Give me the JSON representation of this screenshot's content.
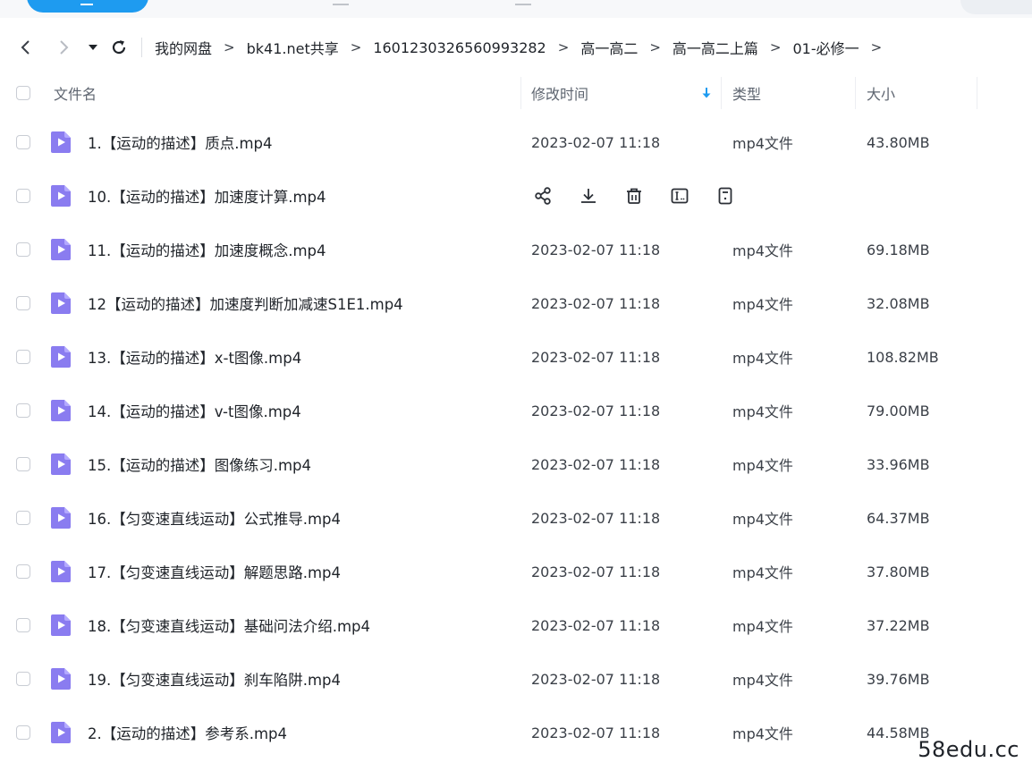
{
  "colors": {
    "accent": "#1e9bf0",
    "video_icon": "#8a7cf0"
  },
  "breadcrumb": [
    "我的网盘",
    "bk41.net共享",
    "1601230326560993282",
    "高一高二",
    "高一高二上篇",
    "01-必修一"
  ],
  "header": {
    "name": "文件名",
    "time": "修改时间",
    "type": "类型",
    "size": "大小",
    "sort_icon": "arrow-down"
  },
  "files": [
    {
      "name": "1.【运动的描述】质点.mp4",
      "time": "2023-02-07 11:18",
      "type": "mp4文件",
      "size": "43.80MB"
    },
    {
      "name": "10.【运动的描述】加速度计算.mp4",
      "hover": true
    },
    {
      "name": "11.【运动的描述】加速度概念.mp4",
      "time": "2023-02-07 11:18",
      "type": "mp4文件",
      "size": "69.18MB"
    },
    {
      "name": "12【运动的描述】加速度判断加减速S1E1.mp4",
      "time": "2023-02-07 11:18",
      "type": "mp4文件",
      "size": "32.08MB"
    },
    {
      "name": "13.【运动的描述】x-t图像.mp4",
      "time": "2023-02-07 11:18",
      "type": "mp4文件",
      "size": "108.82MB"
    },
    {
      "name": "14.【运动的描述】v-t图像.mp4",
      "time": "2023-02-07 11:18",
      "type": "mp4文件",
      "size": "79.00MB"
    },
    {
      "name": "15.【运动的描述】图像练习.mp4",
      "time": "2023-02-07 11:18",
      "type": "mp4文件",
      "size": "33.96MB"
    },
    {
      "name": "16.【匀变速直线运动】公式推导.mp4",
      "time": "2023-02-07 11:18",
      "type": "mp4文件",
      "size": "64.37MB"
    },
    {
      "name": "17.【匀变速直线运动】解题思路.mp4",
      "time": "2023-02-07 11:18",
      "type": "mp4文件",
      "size": "37.80MB"
    },
    {
      "name": "18.【匀变速直线运动】基础问法介绍.mp4",
      "time": "2023-02-07 11:18",
      "type": "mp4文件",
      "size": "37.22MB"
    },
    {
      "name": "19.【匀变速直线运动】刹车陷阱.mp4",
      "time": "2023-02-07 11:18",
      "type": "mp4文件",
      "size": "39.76MB"
    },
    {
      "name": "2.【运动的描述】参考系.mp4",
      "time": "2023-02-07 11:18",
      "type": "mp4文件",
      "size": "44.58MB"
    }
  ],
  "row_actions": [
    "share-icon",
    "download-icon",
    "delete-icon",
    "rename-icon",
    "more-icon"
  ],
  "watermark": "58edu.cc"
}
